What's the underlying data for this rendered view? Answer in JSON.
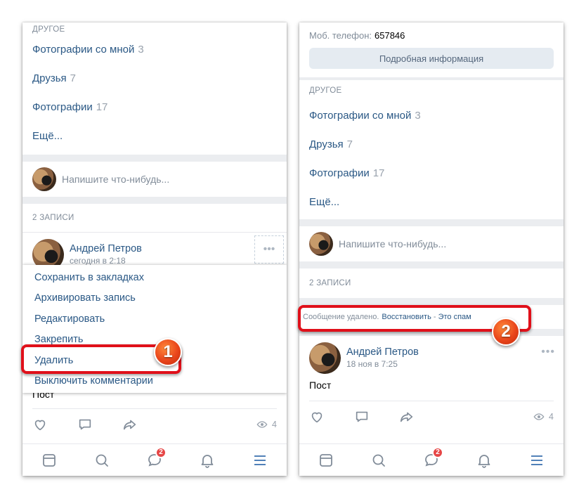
{
  "left": {
    "section_other": "ДРУГОЕ",
    "links": [
      {
        "label": "Фотографии со мной",
        "count": "3"
      },
      {
        "label": "Друзья",
        "count": "7"
      },
      {
        "label": "Фотографии",
        "count": "17"
      },
      {
        "label": "Ещё...",
        "count": ""
      }
    ],
    "composer_placeholder": "Напишите что-нибудь...",
    "posts_header": "2 ЗАПИСИ",
    "post": {
      "author": "Андрей Петров",
      "date": "сегодня в 2:18",
      "text": "Пост",
      "views": "4"
    },
    "menu": [
      "Сохранить в закладках",
      "Архивировать запись",
      "Редактировать",
      "Закрепить",
      "Удалить",
      "Выключить комментарии"
    ],
    "step": "1",
    "messages_badge": "2"
  },
  "right": {
    "phone_label": "Моб. телефон:",
    "phone_value": "657846",
    "details_button": "Подробная информация",
    "section_other": "ДРУГОЕ",
    "links": [
      {
        "label": "Фотографии со мной",
        "count": "3"
      },
      {
        "label": "Друзья",
        "count": "7"
      },
      {
        "label": "Фотографии",
        "count": "17"
      },
      {
        "label": "Ещё...",
        "count": ""
      }
    ],
    "composer_placeholder": "Напишите что-нибудь...",
    "posts_header": "2 ЗАПИСИ",
    "deleted_text": "Сообщение удалено.",
    "restore_link": "Восстановить",
    "separator": " - ",
    "spam_link": "Это спам",
    "post": {
      "author": "Андрей Петров",
      "date": "18 ноя в 7:25",
      "text": "Пост",
      "views": "4"
    },
    "step": "2",
    "messages_badge": "2"
  },
  "colors": {
    "link": "#2a5885",
    "highlight": "#e0101a",
    "badge": "#e64646",
    "icon": "#5181b8"
  },
  "icons": [
    "newsfeed-icon",
    "search-icon",
    "messages-icon",
    "notifications-icon",
    "menu-icon",
    "like-icon",
    "comment-icon",
    "share-icon",
    "views-icon"
  ]
}
